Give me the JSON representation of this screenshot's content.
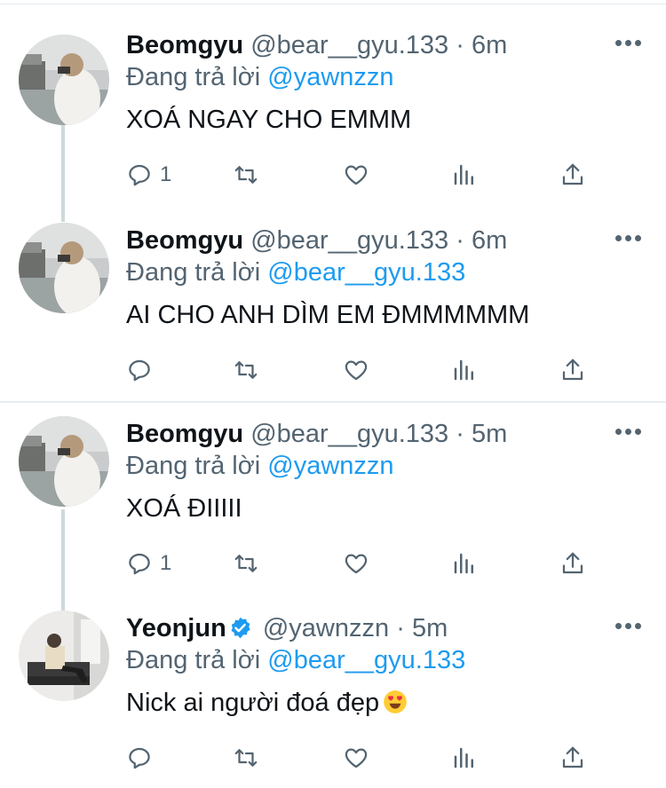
{
  "tweets": [
    {
      "name": "Beomgyu",
      "handle": "@bear__gyu.133",
      "time": "6m",
      "replying_label": "Đang trả lời",
      "replying_to": "@yawnzzn",
      "text": "XOÁ NGAY CHO EMMM",
      "reply_count": "1",
      "verified": false
    },
    {
      "name": "Beomgyu",
      "handle": "@bear__gyu.133",
      "time": "6m",
      "replying_label": "Đang trả lời",
      "replying_to": "@bear__gyu.133",
      "text": "AI CHO ANH DÌM EM ĐMMMMMM",
      "reply_count": "",
      "verified": false
    },
    {
      "name": "Beomgyu",
      "handle": "@bear__gyu.133",
      "time": "5m",
      "replying_label": "Đang trả lời",
      "replying_to": "@yawnzzn",
      "text": "XOÁ ĐIIIII",
      "reply_count": "1",
      "verified": false
    },
    {
      "name": "Yeonjun",
      "handle": "@yawnzzn",
      "time": "5m",
      "replying_label": "Đang trả lời",
      "replying_to": "@bear__gyu.133",
      "text": "Nick ai người đoá đẹp",
      "text_emoji": "heart-eyes-emoji",
      "reply_count": "",
      "verified": true
    }
  ],
  "separator": "·",
  "icons": {
    "reply": "reply-icon",
    "retweet": "retweet-icon",
    "like": "like-icon",
    "analytics": "analytics-icon",
    "share": "share-icon",
    "more": "more-icon",
    "verified": "verified-badge-icon"
  },
  "colors": {
    "accent": "#1d9bf0",
    "secondary_text": "#536471",
    "primary_text": "#0f1419",
    "thread_line": "#cfd9de",
    "divider": "#e6ecf0"
  }
}
